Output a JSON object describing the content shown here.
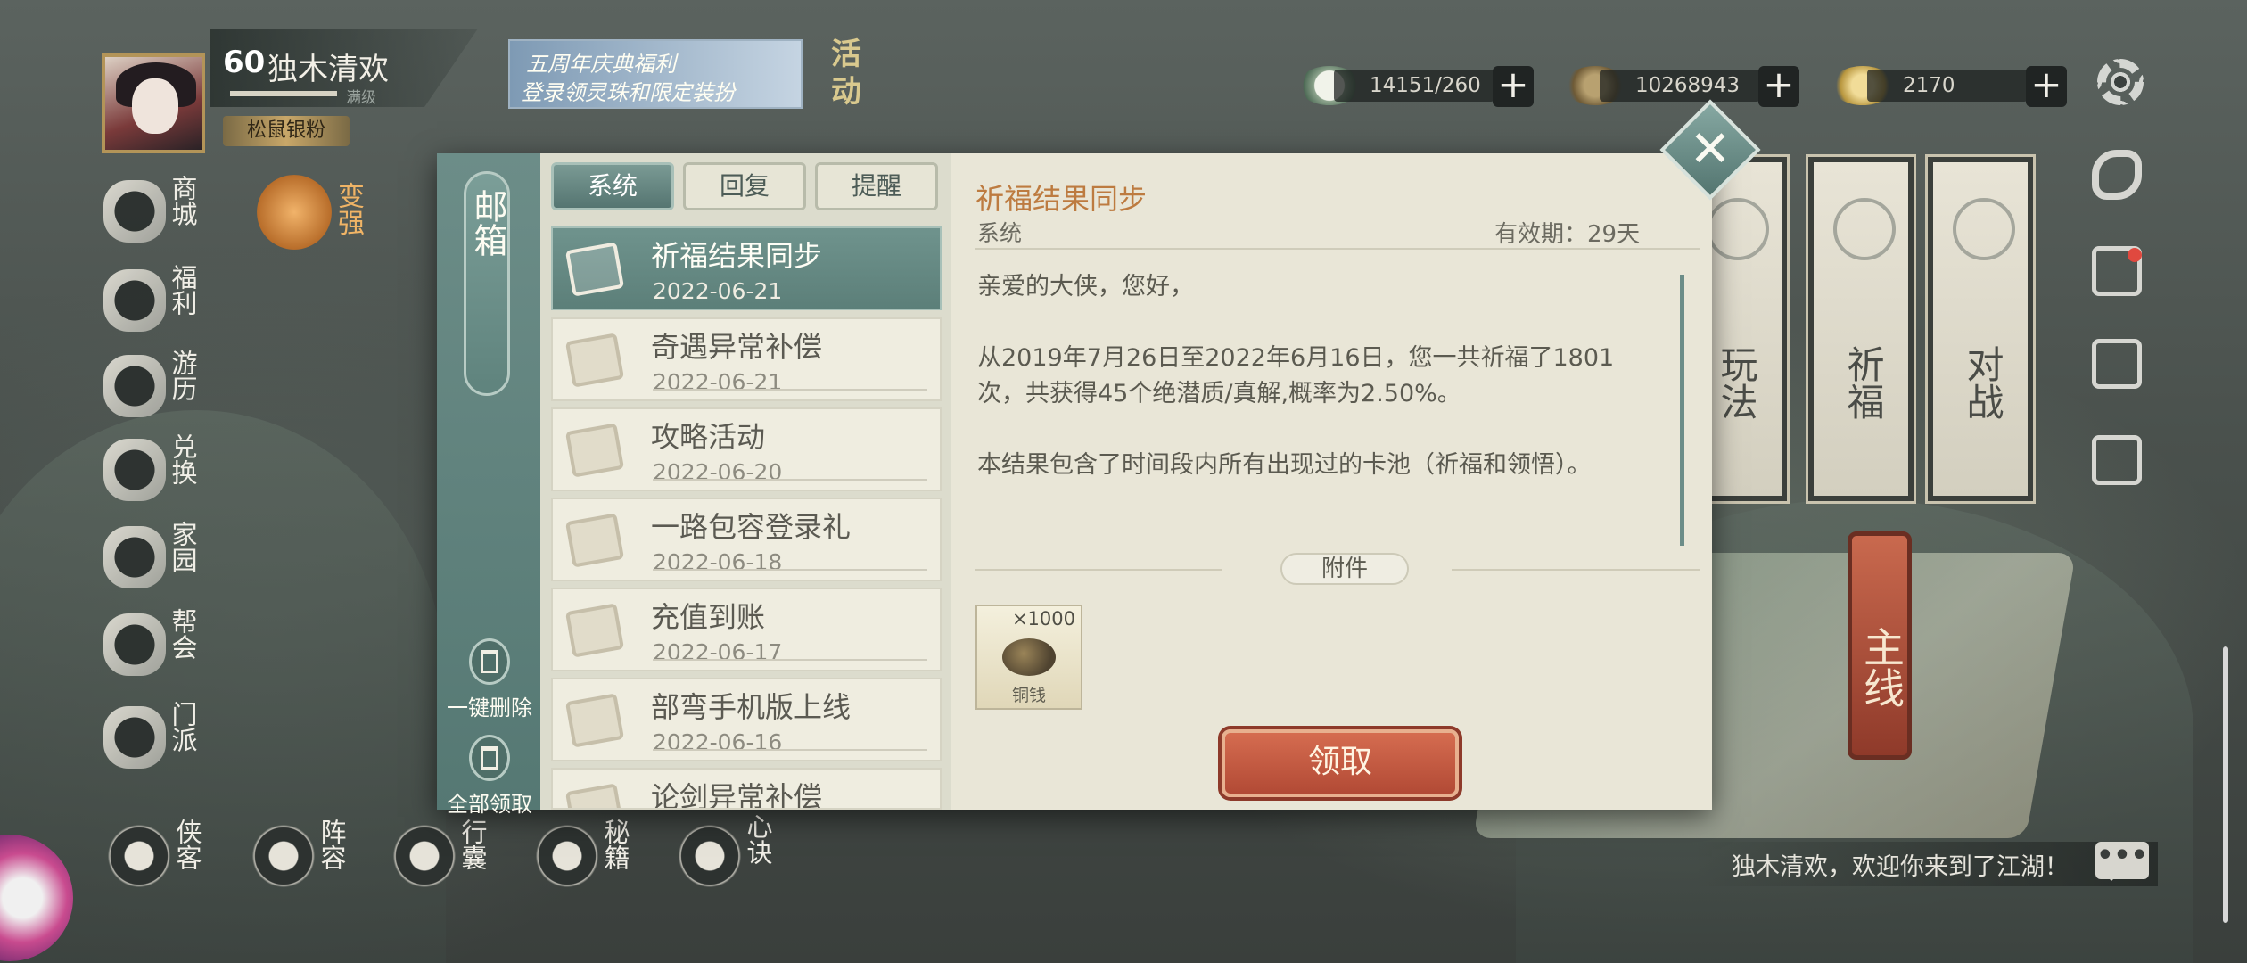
{
  "player": {
    "level": "60",
    "name": "独木清欢",
    "sub": "满级",
    "title": "松鼠银粉"
  },
  "event": {
    "line1": "五周年庆典福利",
    "line2": "登录领灵珠和限定装扮",
    "tag": "活动"
  },
  "resources": [
    {
      "icon": "jade-bun-icon",
      "value": "14151/260"
    },
    {
      "icon": "copper-coin-icon",
      "value": "10268943"
    },
    {
      "icon": "gold-ingot-icon",
      "value": "2170"
    }
  ],
  "left_menu": [
    {
      "icon": "shop-icon",
      "label": "商城"
    },
    {
      "icon": "welfare-icon",
      "label": "福利"
    },
    {
      "icon": "travel-horse-icon",
      "label": "游历"
    },
    {
      "icon": "exchange-icon",
      "label": "兑换"
    },
    {
      "icon": "home-icon",
      "label": "家园"
    },
    {
      "icon": "guild-icon",
      "label": "帮会"
    },
    {
      "icon": "sect-icon",
      "label": "门派"
    }
  ],
  "strengthen": {
    "label": "变强"
  },
  "bottom_menu": [
    {
      "icon": "hero-icon",
      "label": "侠客"
    },
    {
      "icon": "formation-icon",
      "label": "阵容"
    },
    {
      "icon": "bag-icon",
      "label": "行囊"
    },
    {
      "icon": "secret-book-icon",
      "label": "秘籍"
    },
    {
      "icon": "mind-art-icon",
      "label": "心诀"
    }
  ],
  "scrolls": [
    {
      "label": "玩法"
    },
    {
      "label": "祈福"
    },
    {
      "label": "对战"
    }
  ],
  "main_line": "主线",
  "welcome": "独木清欢，欢迎你来到了江湖！",
  "chat_icon": "•••",
  "mail": {
    "title": "邮箱",
    "tabs": [
      "系统",
      "回复",
      "提醒"
    ],
    "delete_all": "一键删除",
    "claim_all": "全部领取",
    "items": [
      {
        "subject": "祈福结果同步",
        "date": "2022-06-21"
      },
      {
        "subject": "奇遇异常补偿",
        "date": "2022-06-21"
      },
      {
        "subject": "攻略活动",
        "date": "2022-06-20"
      },
      {
        "subject": "一路包容登录礼",
        "date": "2022-06-18"
      },
      {
        "subject": "充值到账",
        "date": "2022-06-17"
      },
      {
        "subject": "部弯手机版上线",
        "date": "2022-06-16"
      },
      {
        "subject": "论剑异常补偿",
        "date": ""
      }
    ],
    "detail": {
      "title": "祈福结果同步",
      "sender": "系统",
      "validity": "有效期：29天",
      "body": "亲爱的大侠，您好，\n\n从2019年7月26日至2022年6月16日，您一共祈福了1801次，共获得45个绝潜质/真解,概率为2.50%。\n\n本结果包含了时间段内所有出现过的卡池（祈福和领悟）。",
      "attachment_label": "附件",
      "attachment": {
        "name": "铜钱",
        "qty": "×1000"
      },
      "claim": "领取"
    },
    "close": "✕"
  }
}
